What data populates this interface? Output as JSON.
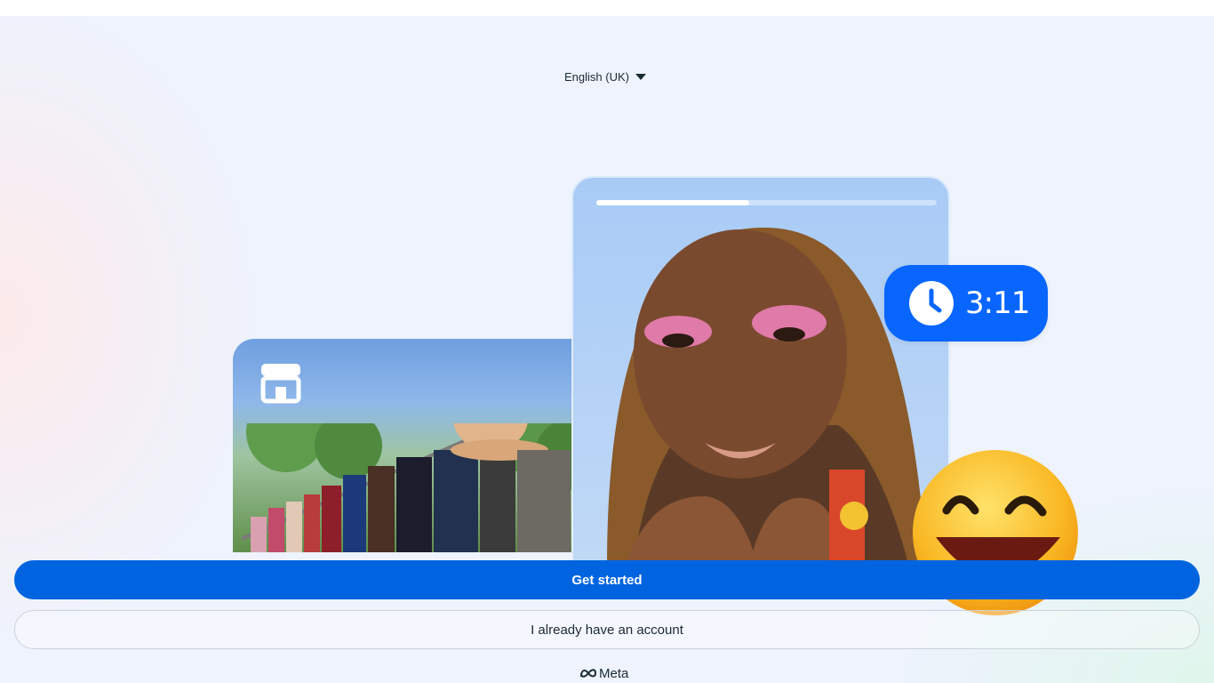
{
  "language": {
    "label": "English (UK)",
    "icon": "caret-down-icon"
  },
  "illustration": {
    "timer": {
      "time": "3:11",
      "icon": "clock-icon"
    },
    "story_progress": 0.45,
    "store_icon": "storefront-icon",
    "emoji": "laughing-emoji"
  },
  "actions": {
    "primary": "Get started",
    "secondary": "I already have an account"
  },
  "footer": {
    "brand": "Meta",
    "icon": "meta-logo-icon"
  },
  "colors": {
    "primary": "#0064e0",
    "timer": "#0866ff",
    "text": "#1c2b33"
  }
}
